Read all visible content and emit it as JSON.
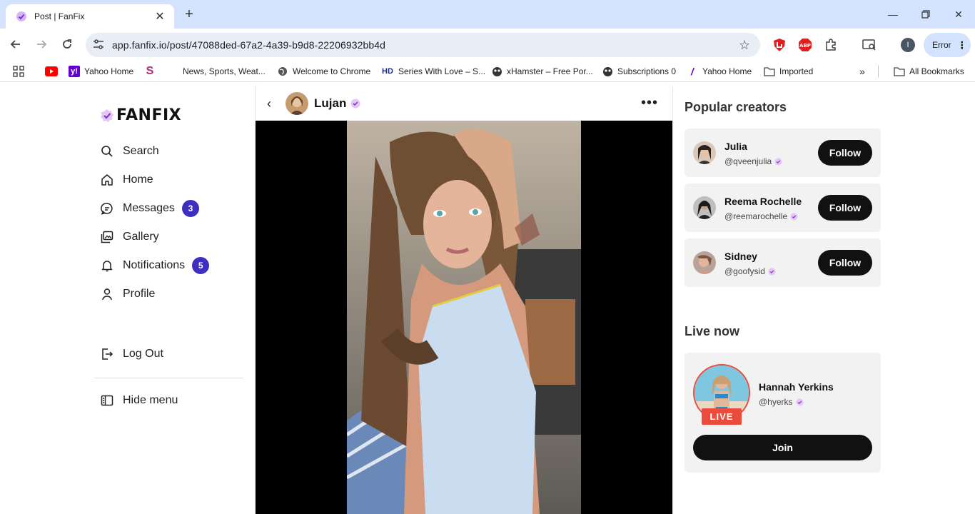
{
  "browser": {
    "tab_title": "Post | FanFix",
    "url": "app.fanfix.io/post/47088ded-67a2-4a39-b9d8-22206932bb4d",
    "profile_initial": "I",
    "error_label": "Error",
    "bookmarks": [
      {
        "label": "Yahoo Home",
        "icon": "yahoo-icon"
      },
      {
        "label": "News, Sports, Weat...",
        "icon": "s-icon"
      },
      {
        "label": "Welcome to Chrome",
        "icon": "globe-icon"
      },
      {
        "label": "Series With Love – S...",
        "icon": "hd-icon"
      },
      {
        "label": "xHamster – Free Por...",
        "icon": "mask-icon"
      },
      {
        "label": "Subscriptions 0",
        "icon": "mask-icon"
      },
      {
        "label": "Yahoo Home",
        "icon": "yahoo-slash-icon"
      },
      {
        "label": "Imported",
        "icon": "folder-icon"
      },
      {
        "label": "All Bookmarks",
        "icon": "folder-icon"
      }
    ]
  },
  "sidebar": {
    "logo": "FANFIX",
    "items": [
      {
        "label": "Search",
        "icon": "search-icon"
      },
      {
        "label": "Home",
        "icon": "home-icon"
      },
      {
        "label": "Messages",
        "icon": "messages-icon",
        "badge": "3"
      },
      {
        "label": "Gallery",
        "icon": "gallery-icon"
      },
      {
        "label": "Notifications",
        "icon": "bell-icon",
        "badge": "5"
      },
      {
        "label": "Profile",
        "icon": "profile-icon"
      },
      {
        "label": "Log Out",
        "icon": "logout-icon"
      },
      {
        "label": "Hide menu",
        "icon": "sidebar-icon"
      }
    ]
  },
  "post": {
    "creator_name": "Lujan"
  },
  "popular": {
    "title": "Popular creators",
    "creators": [
      {
        "name": "Julia",
        "handle": "@qveenjulia",
        "button": "Follow"
      },
      {
        "name": "Reema Rochelle",
        "handle": "@reemarochelle",
        "button": "Follow"
      },
      {
        "name": "Sidney",
        "handle": "@goofysid",
        "button": "Follow"
      }
    ]
  },
  "live": {
    "title": "Live now",
    "name": "Hannah Yerkins",
    "handle": "@hyerks",
    "tag": "LIVE",
    "button": "Join"
  },
  "colors": {
    "accent_badge": "#3d2fbf",
    "live_red": "#e94b3c",
    "button_black": "#111111",
    "card_bg": "#f2f2f2",
    "chrome_blue": "#d3e3fd"
  }
}
